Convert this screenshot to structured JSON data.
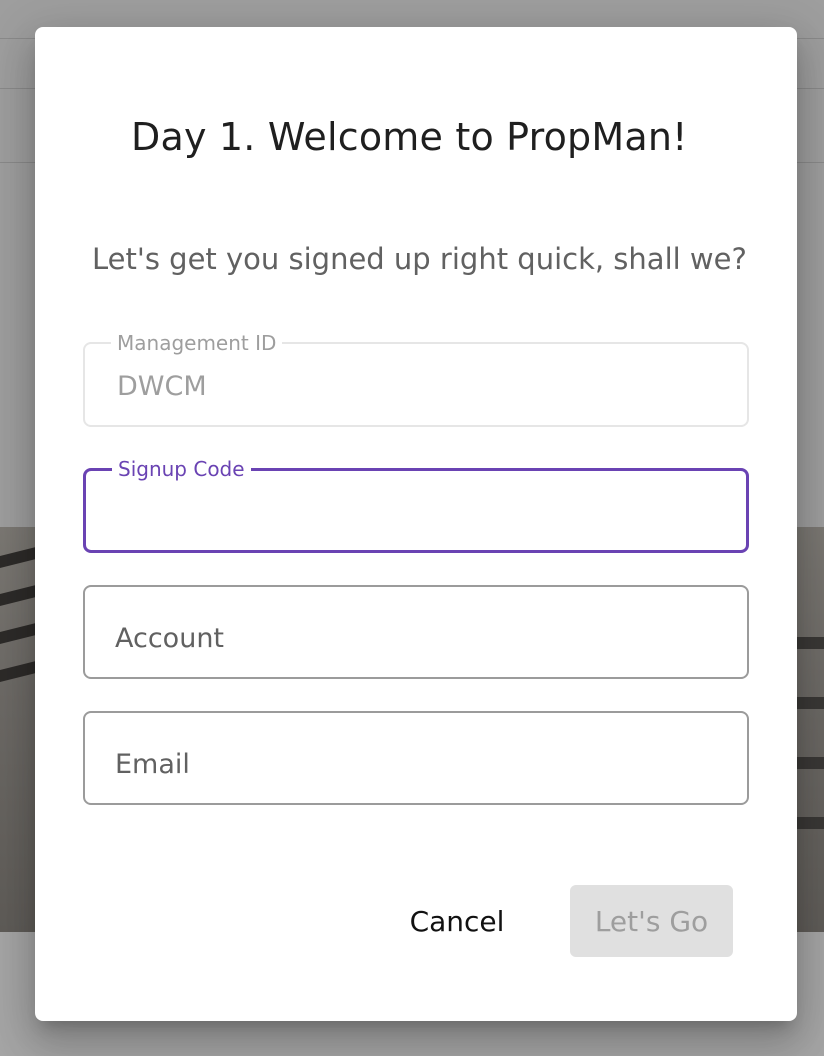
{
  "dialog": {
    "title": "Day 1. Welcome to PropMan!",
    "subtitle": "Let's get you signed up right quick, shall we?"
  },
  "fields": {
    "management_id": {
      "label": "Management ID",
      "value": "DWCM",
      "disabled": true
    },
    "signup_code": {
      "label": "Signup Code",
      "value": "",
      "focused": true
    },
    "account": {
      "placeholder": "Account",
      "value": ""
    },
    "email": {
      "placeholder": "Email",
      "value": ""
    }
  },
  "actions": {
    "cancel_label": "Cancel",
    "submit_label": "Let's Go",
    "submit_disabled": true
  },
  "colors": {
    "accent": "#6a43b3",
    "disabled_button_bg": "#e0e0e0",
    "overlay": "#9e9e9e"
  }
}
